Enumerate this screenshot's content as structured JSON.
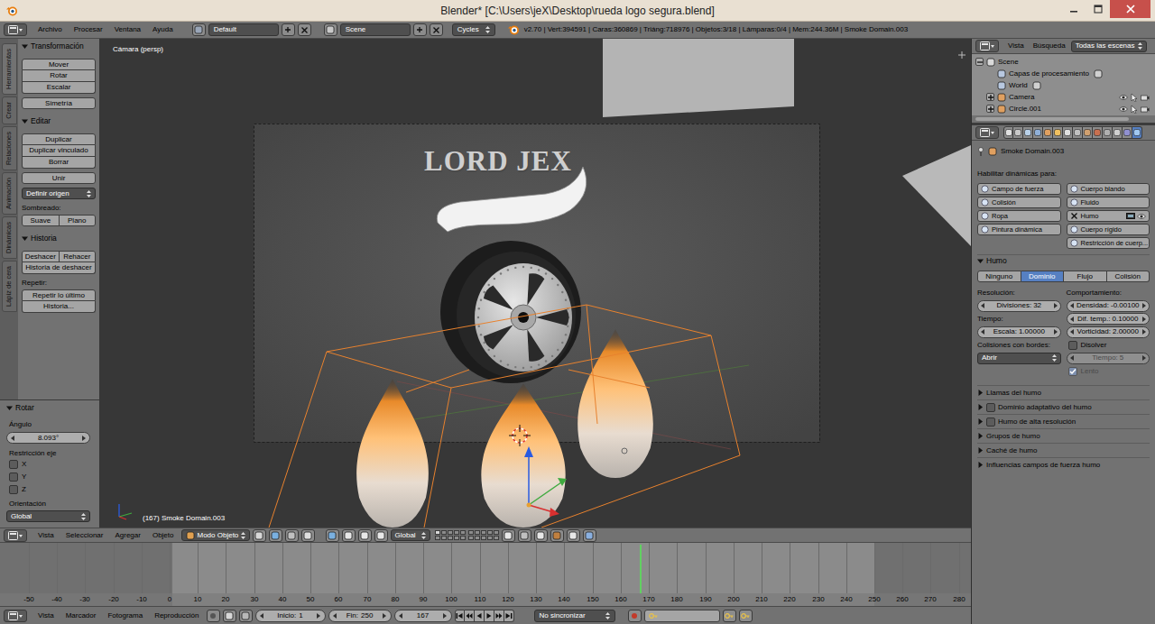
{
  "window": {
    "title": "Blender* [C:\\Users\\jeX\\Desktop\\rueda logo segura.blend]"
  },
  "info_header": {
    "menus": [
      "Archivo",
      "Procesar",
      "Ventana",
      "Ayuda"
    ],
    "layout": "Default",
    "scene": "Scene",
    "engine": "Cycles",
    "stats": "v2.70 | Vert:394591 | Caras:360869 | Triáng:718976 | Objetos:3/18 | Lámparas:0/4 | Mem:244.36M | Smoke Domain.003"
  },
  "toolshelf": {
    "tabs": [
      {
        "label": "Herramientas",
        "selected": true
      },
      {
        "label": "Crear",
        "selected": false
      },
      {
        "label": "Relaciones",
        "selected": false
      },
      {
        "label": "Animación",
        "selected": false
      },
      {
        "label": "Dinámicas",
        "selected": false
      },
      {
        "label": "Lápiz de cera",
        "selected": false
      }
    ],
    "panels": [
      {
        "title": "Transformación",
        "expanded": true,
        "groups": [
          [
            {
              "kind": "button",
              "label": "Mover"
            },
            {
              "kind": "button",
              "label": "Rotar"
            },
            {
              "kind": "button",
              "label": "Escalar"
            }
          ],
          [
            {
              "kind": "button",
              "label": "Simetría"
            }
          ]
        ]
      },
      {
        "title": "Editar",
        "expanded": true,
        "groups": [
          [
            {
              "kind": "button",
              "label": "Duplicar"
            },
            {
              "kind": "button",
              "label": "Duplicar vinculado"
            },
            {
              "kind": "button",
              "label": "Borrar"
            }
          ],
          [
            {
              "kind": "button",
              "label": "Unir"
            }
          ],
          [
            {
              "kind": "dropdown",
              "label": "Definir origen"
            }
          ],
          [
            {
              "kind": "label",
              "label": "Sombreado:"
            },
            {
              "kind": "row",
              "labels": [
                "Suave",
                "Plano"
              ]
            }
          ]
        ]
      },
      {
        "title": "Historia",
        "expanded": true,
        "groups": [
          [
            {
              "kind": "row",
              "labels": [
                "Deshacer",
                "Rehacer"
              ]
            },
            {
              "kind": "button",
              "label": "Historia de deshacer"
            }
          ],
          [
            {
              "kind": "label",
              "label": "Repetir:"
            },
            {
              "kind": "button",
              "label": "Repetir lo último"
            },
            {
              "kind": "button",
              "label": "Historia..."
            }
          ]
        ]
      }
    ]
  },
  "operator": {
    "title": "Rotar",
    "expanded": true,
    "angle_label": "Ángulo",
    "angle": "8.093°",
    "axis_label": "Restricción eje",
    "axes": [
      {
        "label": "X",
        "checked": false
      },
      {
        "label": "Y",
        "checked": false
      },
      {
        "label": "Z",
        "checked": false
      }
    ],
    "orientation_label": "Orientación",
    "orientation": "Global"
  },
  "viewport": {
    "view_label": "Cámara (persp)",
    "object_label": "(167) Smoke Domain.003",
    "logo_text": "LORD JEX"
  },
  "outliner": {
    "menus": [
      "Vista",
      "Búsqueda"
    ],
    "filter": "Todas las escenas",
    "tree": [
      {
        "label": "Scene",
        "kind": "scene",
        "expanded": true,
        "children": [
          {
            "label": "Capas de procesamiento",
            "kind": "item"
          },
          {
            "label": "World",
            "kind": "item"
          },
          {
            "label": "Camera",
            "kind": "object",
            "expanded": false
          },
          {
            "label": "Circle.001",
            "kind": "object",
            "expanded": false
          }
        ]
      }
    ]
  },
  "properties": {
    "tabs": [
      {
        "selected": false
      },
      {
        "selected": false
      },
      {
        "selected": false
      },
      {
        "selected": false
      },
      {
        "selected": false
      },
      {
        "selected": false
      },
      {
        "selected": false
      },
      {
        "selected": false
      },
      {
        "selected": false
      },
      {
        "selected": false
      },
      {
        "selected": false
      },
      {
        "selected": false
      },
      {
        "selected": false
      },
      {
        "selected": true
      }
    ],
    "context": "Smoke Domain.003",
    "physics_label": "Habilitar dinámicas para:",
    "physics": [
      {
        "label": "Campo de fuerza",
        "enabled": false
      },
      {
        "label": "Cuerpo blando",
        "enabled": false
      },
      {
        "label": "Colisión",
        "enabled": false
      },
      {
        "label": "Fluido",
        "enabled": false
      },
      {
        "label": "Ropa",
        "enabled": false
      },
      {
        "label": "Humo",
        "enabled": true
      },
      {
        "label": "Pintura dinámica",
        "enabled": false
      },
      {
        "label": "Cuerpo rígido",
        "enabled": false
      },
      {
        "label": "Restricción de cuerp...",
        "enabled": false
      }
    ],
    "smoke": {
      "title": "Humo",
      "expanded": true,
      "types": [
        {
          "label": "Ninguno",
          "selected": false
        },
        {
          "label": "Dominio",
          "selected": true
        },
        {
          "label": "Flujo",
          "selected": false
        },
        {
          "label": "Colisión",
          "selected": false
        }
      ],
      "left": [
        {
          "kind": "label",
          "label": "Resolución:",
          "disabled": false
        },
        {
          "kind": "number",
          "label": "Divisiones:",
          "value": "32",
          "disabled": false
        },
        {
          "kind": "label",
          "label": "Tiempo:",
          "disabled": false
        },
        {
          "kind": "number",
          "label": "Escala:",
          "value": "1.00000",
          "disabled": false
        },
        {
          "kind": "label",
          "label": "Colisiones con bordes:",
          "disabled": false
        },
        {
          "kind": "dropdown",
          "value": "Abrir",
          "disabled": false
        }
      ],
      "right": [
        {
          "kind": "label",
          "label": "Comportamiento:",
          "disabled": false
        },
        {
          "kind": "number",
          "label": "Densidad:",
          "value": "-0.00100",
          "disabled": false
        },
        {
          "kind": "number",
          "label": "Dif. temp.:",
          "value": "0.10000",
          "disabled": false
        },
        {
          "kind": "number",
          "label": "Vorticidad:",
          "value": "2.00000",
          "disabled": false
        },
        {
          "kind": "checkbox",
          "label": "Disolver",
          "checked": false,
          "disabled": false
        },
        {
          "kind": "number",
          "label": "Tiempo:",
          "value": "5",
          "disabled": true
        },
        {
          "kind": "checkbox",
          "label": "Lento",
          "checked": true,
          "disabled": true
        }
      ]
    },
    "subpanels": [
      {
        "label": "Llamas del humo",
        "kind": "plain",
        "expanded": false
      },
      {
        "label": "Dominio adaptativo del humo",
        "kind": "toggle",
        "expanded": false,
        "checked": false
      },
      {
        "label": "Humo de alta resolución",
        "kind": "toggle",
        "expanded": false,
        "checked": false
      },
      {
        "label": "Grupos de humo",
        "kind": "plain",
        "expanded": false
      },
      {
        "label": "Caché de humo",
        "kind": "plain",
        "expanded": false
      },
      {
        "label": "Influencias campos de fuerza humo",
        "kind": "plain",
        "expanded": false
      }
    ]
  },
  "view3d_header": {
    "menus": [
      "Vista",
      "Seleccionar",
      "Agregar",
      "Objeto"
    ],
    "mode": "Modo Objeto",
    "orientation": "Global",
    "layers": [
      {
        "active": true
      },
      {
        "active": false
      },
      {
        "active": false
      },
      {
        "active": false
      },
      {
        "active": false
      },
      {
        "active": false
      },
      {
        "active": false
      },
      {
        "active": false
      },
      {
        "active": false
      },
      {
        "active": false
      },
      {
        "active": false
      },
      {
        "active": false
      },
      {
        "active": false
      },
      {
        "active": false
      },
      {
        "active": false
      },
      {
        "active": false
      },
      {
        "active": false
      },
      {
        "active": false
      },
      {
        "active": false
      },
      {
        "active": false
      }
    ]
  },
  "timeline": {
    "ticks": [
      "-50",
      "-40",
      "-30",
      "-20",
      "-10",
      "0",
      "10",
      "20",
      "30",
      "40",
      "50",
      "60",
      "70",
      "80",
      "90",
      "100",
      "110",
      "120",
      "130",
      "140",
      "150",
      "160",
      "170",
      "180",
      "190",
      "200",
      "210",
      "220",
      "230",
      "240",
      "250",
      "260",
      "270",
      "280"
    ]
  },
  "timeline_header": {
    "menus": [
      "Vista",
      "Marcador",
      "Fotograma",
      "Reproducción"
    ],
    "start_label": "Inicio:",
    "start": "1",
    "end_label": "Fin:",
    "end": "250",
    "current": "167",
    "sync": "No sincronizar"
  }
}
